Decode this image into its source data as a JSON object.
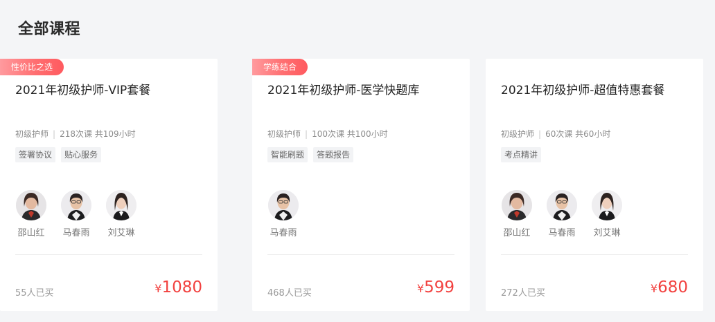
{
  "page": {
    "section_title": "全部课程"
  },
  "courses": [
    {
      "badge": "学练结合",
      "title": "2021年初级护师-医学快题库",
      "category": "初级护师",
      "lessons": "100次课 共100小时",
      "tags": [
        "智能刷题",
        "答题报告"
      ],
      "teachers": [
        {
          "name": "马春雨",
          "avatar_icon": "teacher-avatar-icon"
        }
      ],
      "sold": "468人已买",
      "currency": "¥",
      "price": "599"
    },
    {
      "badge": "",
      "title": "2021年初级护师-超值特惠套餐",
      "category": "初级护师",
      "lessons": "60次课 共60小时",
      "tags": [
        "考点精讲"
      ],
      "teachers": [
        {
          "name": "邵山红",
          "avatar_icon": "teacher-avatar-icon"
        },
        {
          "name": "马春雨",
          "avatar_icon": "teacher-avatar-icon"
        },
        {
          "name": "刘艾琳",
          "avatar_icon": "teacher-avatar-icon"
        }
      ],
      "sold": "272人已买",
      "currency": "¥",
      "price": "680"
    },
    {
      "badge": "性价比之选",
      "title": "2021年初级护师-VIP套餐",
      "category": "初级护师",
      "lessons": "218次课 共109小时",
      "tags": [
        "签署协议",
        "贴心服务"
      ],
      "teachers": [
        {
          "name": "邵山红",
          "avatar_icon": "teacher-avatar-icon"
        },
        {
          "name": "马春雨",
          "avatar_icon": "teacher-avatar-icon"
        },
        {
          "name": "刘艾琳",
          "avatar_icon": "teacher-avatar-icon"
        }
      ],
      "sold": "55人已买",
      "currency": "¥",
      "price": "1080"
    }
  ],
  "colors": {
    "page_background": "#f4f5f7",
    "card_background": "#ffffff",
    "price": "#f2413f",
    "badge_start": "#ff9a9e",
    "badge_end": "#ff5a5f",
    "tag_background": "#f2f3f5"
  }
}
